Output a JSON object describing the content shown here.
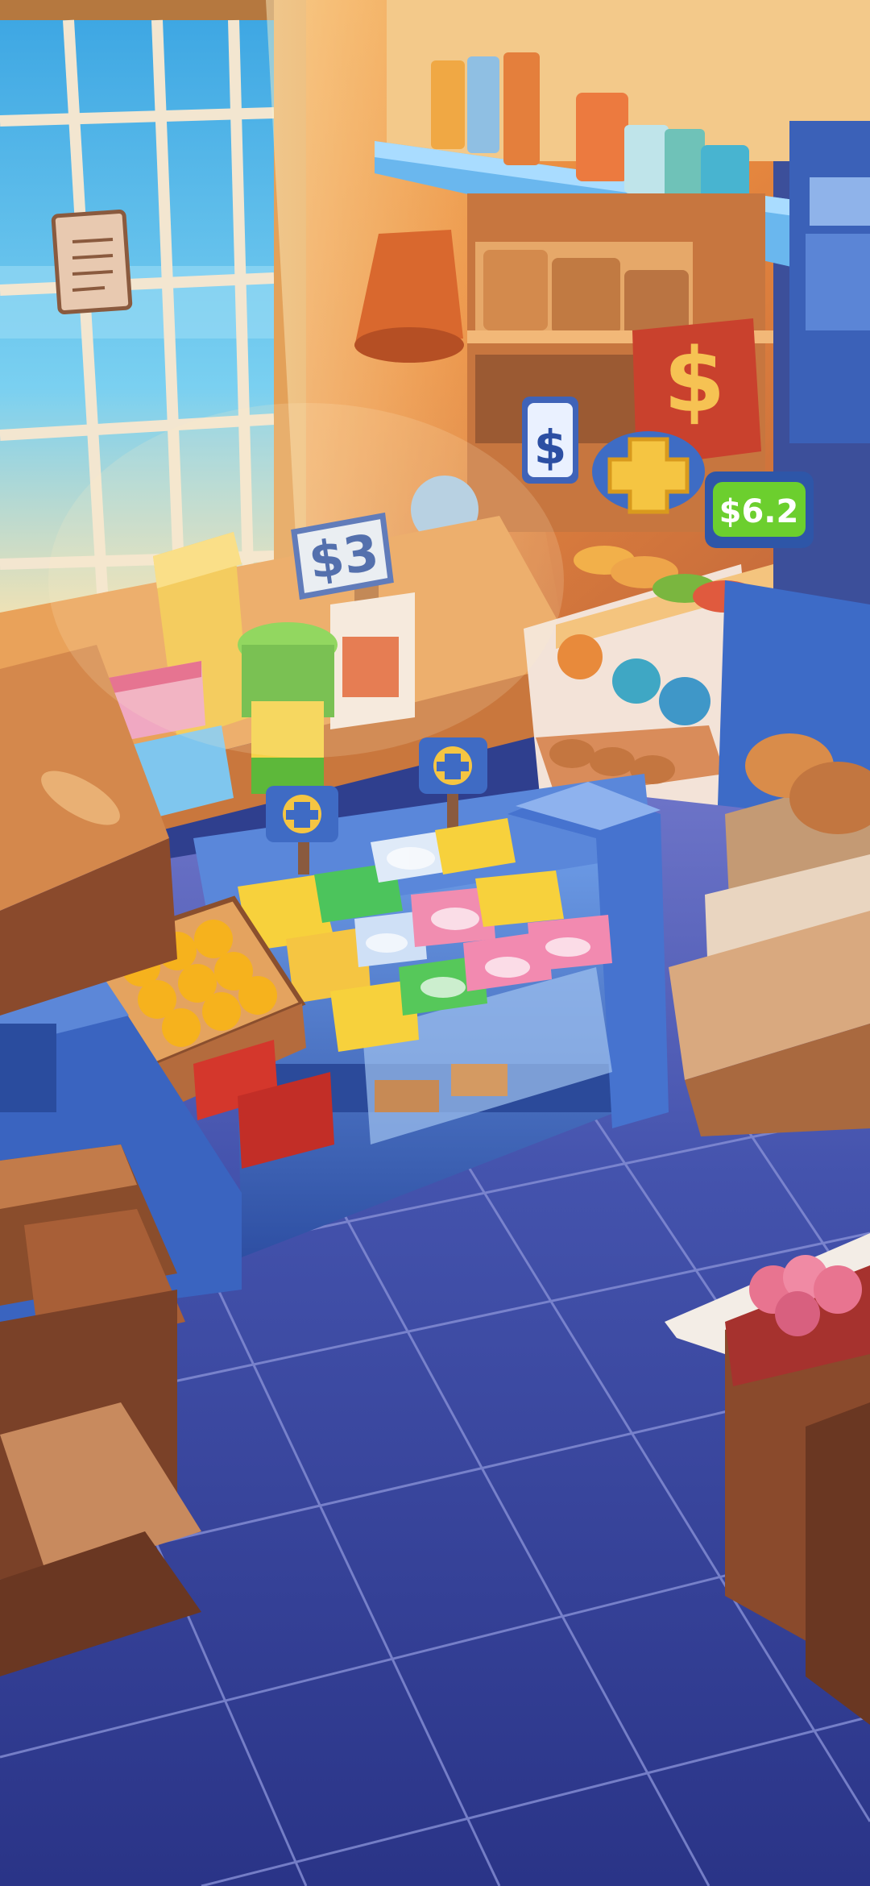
{
  "scene": {
    "type": "shop-interior-illustration",
    "price_sign_left": "$3",
    "price_sign_right": "$6.2",
    "dollar_sign_small": "$",
    "dollar_sign_poster": "$"
  },
  "colors": {
    "floor": "#3a4aa0",
    "floor_grid": "#7a86d0",
    "window_sky": "#4fb3e6",
    "wall_warm": "#e58a3c",
    "counter_blue": "#3d6fc4",
    "price_tag_green": "#6ccf2e",
    "price_tag_blue": "#3d63b8"
  },
  "icons": [
    "plus-token-icon",
    "dollar-icon"
  ]
}
